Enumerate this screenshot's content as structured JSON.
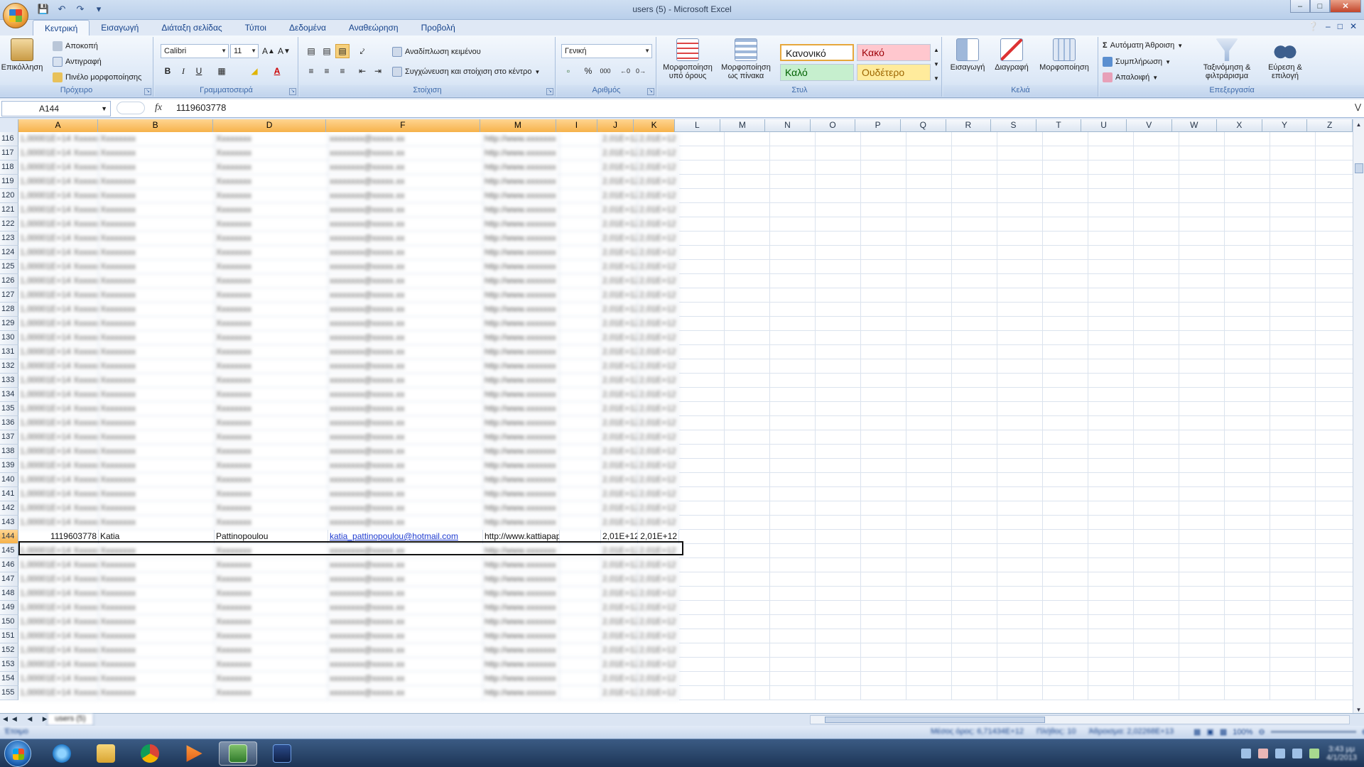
{
  "window": {
    "title": "users (5) - Microsoft Excel"
  },
  "tabs": [
    "Κεντρική",
    "Εισαγωγή",
    "Διάταξη σελίδας",
    "Τύποι",
    "Δεδομένα",
    "Αναθεώρηση",
    "Προβολή"
  ],
  "ribbon": {
    "clipboard": {
      "label": "Πρόχειρο",
      "paste": "Επικόλληση",
      "cut": "Αποκοπή",
      "copy": "Αντιγραφή",
      "format_painter": "Πινέλο μορφοποίησης"
    },
    "font": {
      "label": "Γραμματοσειρά",
      "name": "Calibri",
      "size": "11"
    },
    "alignment": {
      "label": "Στοίχιση",
      "wrap": "Αναδίπλωση κειμένου",
      "merge": "Συγχώνευση και στοίχιση στο κέντρο"
    },
    "number": {
      "label": "Αριθμός",
      "format": "Γενική"
    },
    "styles": {
      "label": "Στυλ",
      "conditional": "Μορφοποίηση υπό όρους",
      "as_table": "Μορφοποίηση ως πίνακα",
      "normal": "Κανονικό",
      "bad": "Κακό",
      "good": "Καλό",
      "neutral": "Ουδέτερο"
    },
    "cells": {
      "label": "Κελιά",
      "insert": "Εισαγωγή",
      "delete": "Διαγραφή",
      "format": "Μορφοποίηση"
    },
    "editing": {
      "label": "Επεξεργασία",
      "autosum": "Αυτόματη Άθροιση",
      "fill": "Συμπλήρωση",
      "clear": "Απαλοιφή",
      "sort": "Ταξινόμηση & φιλτράρισμα",
      "find": "Εύρεση & επιλογή"
    }
  },
  "formula_bar": {
    "name_box": "A144",
    "fx": "fx",
    "value": "1119603778"
  },
  "grid": {
    "columns": [
      {
        "name": "A",
        "sel": true
      },
      {
        "name": "B",
        "sel": true
      },
      {
        "name": "D",
        "sel": true
      },
      {
        "name": "F",
        "sel": true
      },
      {
        "name": "M",
        "sel": true
      },
      {
        "name": "I",
        "sel": true
      },
      {
        "name": "J",
        "sel": true
      },
      {
        "name": "K",
        "sel": true
      },
      {
        "name": "L"
      },
      {
        "name": "M"
      },
      {
        "name": "N"
      },
      {
        "name": "O"
      },
      {
        "name": "P"
      },
      {
        "name": "Q"
      },
      {
        "name": "R"
      },
      {
        "name": "S"
      },
      {
        "name": "T"
      },
      {
        "name": "U"
      },
      {
        "name": "V"
      },
      {
        "name": "W"
      },
      {
        "name": "X"
      },
      {
        "name": "Y"
      },
      {
        "name": "Z"
      }
    ],
    "active_row": {
      "row": "144",
      "a": "1119603778",
      "b": "Katia",
      "d": "Pattinopoulou",
      "f": "katia_pattinopoulou@hotmail.com",
      "m": "http://www.kattiapapa",
      "j": "2,01E+12",
      "k": "2,01E+12"
    },
    "row_numbers": [
      "116",
      "117",
      "118",
      "119",
      "120",
      "121",
      "122",
      "123",
      "124",
      "125",
      "126",
      "127",
      "128",
      "129",
      "130",
      "131",
      "132",
      "133",
      "134",
      "135",
      "136",
      "137",
      "138",
      "139",
      "140",
      "141",
      "142",
      "143",
      "144",
      "145",
      "146",
      "147",
      "148",
      "149",
      "150",
      "151",
      "152",
      "153",
      "154",
      "155"
    ]
  },
  "sheet_tab": "users (5)",
  "status": {
    "ready": "Έτοιμο",
    "average": "Μέσος όρος: 6,71434E+12",
    "count": "Πλήθος: 10",
    "sum": "Άθροισμα: 2,02268E+13",
    "zoom": "100%"
  },
  "taskbar": {
    "time": "3:43 μμ",
    "date": "4/1/2013"
  },
  "icons": {
    "office": "office-logo-icon",
    "start": "windows-start-icon"
  }
}
